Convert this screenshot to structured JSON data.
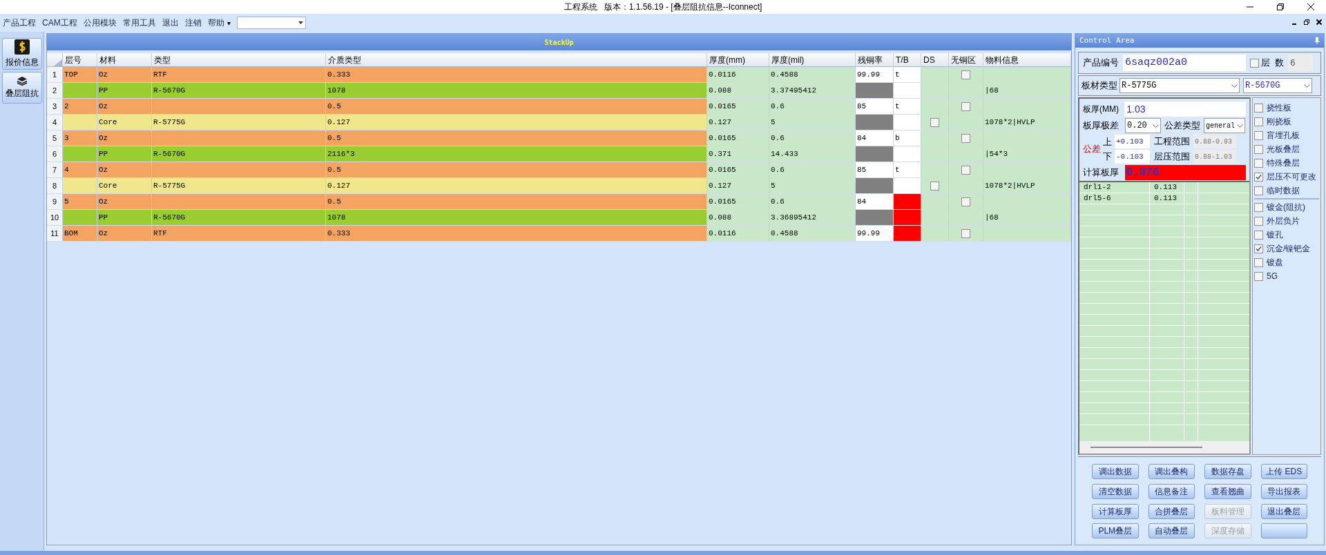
{
  "window": {
    "title": "工程系统   版本：1.1.56.19 - [叠层阻抗信息--Iconnect]"
  },
  "menu": {
    "items": [
      "产品工程",
      "CAM工程",
      "公用模块",
      "常用工具",
      "退出",
      "注销",
      "帮助"
    ],
    "overflow": "▾"
  },
  "sidebar": {
    "items": [
      {
        "label": "报价信息"
      },
      {
        "label": "叠层阻抗"
      }
    ]
  },
  "grid": {
    "title": "StackUp",
    "columns": [
      "层号",
      "材料",
      "类型",
      "介质类型",
      "厚度(mm)",
      "厚度(mil)",
      "残铜率",
      "T/B",
      "DS",
      "无铜区",
      "物料信息"
    ],
    "rows": [
      {
        "index": "1",
        "kind": "copper",
        "layer": "TOP",
        "material": "Oz",
        "type": "RTF",
        "dielectric": "0.333",
        "thk_mm": "0.0116",
        "thk_mil": "0.4588",
        "copper_rate": "99.99",
        "tb": "t",
        "tb_alert": false,
        "no_copper": false
      },
      {
        "index": "2",
        "kind": "pp",
        "material": "PP",
        "type": "R-5670G",
        "dielectric": "1078",
        "thk_mm": "0.088",
        "thk_mil": "3.37495412",
        "tb_alert": false,
        "info": "|68"
      },
      {
        "index": "3",
        "kind": "copper",
        "layer": "2",
        "material": "Oz",
        "dielectric": "0.5",
        "thk_mm": "0.0165",
        "thk_mil": "0.6",
        "copper_rate": "85",
        "tb": "t",
        "tb_alert": false,
        "no_copper": false
      },
      {
        "index": "4",
        "kind": "core",
        "material": "Core",
        "type": "R-5775G",
        "dielectric": "0.127",
        "thk_mm": "0.127",
        "thk_mil": "5",
        "tb_alert": false,
        "ds": false,
        "info": "1078*2|HVLP"
      },
      {
        "index": "5",
        "kind": "copper",
        "layer": "3",
        "material": "Oz",
        "dielectric": "0.5",
        "thk_mm": "0.0165",
        "thk_mil": "0.6",
        "copper_rate": "84",
        "tb": "b",
        "tb_alert": false,
        "no_copper": false
      },
      {
        "index": "6",
        "kind": "pp",
        "material": "PP",
        "type": "R-5670G",
        "dielectric": "2116*3",
        "thk_mm": "0.371",
        "thk_mil": "14.433",
        "tb_alert": false,
        "info": "|54*3"
      },
      {
        "index": "7",
        "kind": "copper",
        "layer": "4",
        "material": "Oz",
        "dielectric": "0.5",
        "thk_mm": "0.0165",
        "thk_mil": "0.6",
        "copper_rate": "85",
        "tb": "t",
        "tb_alert": false,
        "no_copper": false
      },
      {
        "index": "8",
        "kind": "core",
        "material": "Core",
        "type": "R-5775G",
        "dielectric": "0.127",
        "thk_mm": "0.127",
        "thk_mil": "5",
        "tb_alert": false,
        "ds": false,
        "info": "1078*2|HVLP"
      },
      {
        "index": "9",
        "kind": "copper",
        "layer": "5",
        "material": "Oz",
        "dielectric": "0.5",
        "thk_mm": "0.0165",
        "thk_mil": "0.6",
        "copper_rate": "84",
        "tb": "b",
        "tb_alert": true,
        "no_copper": false
      },
      {
        "index": "10",
        "kind": "pp",
        "material": "PP",
        "type": "R-5670G",
        "dielectric": "1078",
        "thk_mm": "0.088",
        "thk_mil": "3.36895412",
        "tb_alert": true,
        "info": "|68"
      },
      {
        "index": "11",
        "kind": "copper",
        "layer": "BOM",
        "material": "Oz",
        "type": "RTF",
        "dielectric": "0.333",
        "thk_mm": "0.0116",
        "thk_mil": "0.4588",
        "copper_rate": "99.99",
        "tb": "b",
        "tb_alert": true,
        "no_copper": false
      }
    ]
  },
  "control_area": {
    "title": "Control Area",
    "product_label": "产品编号",
    "product_value": "6saqz002a0",
    "layer_count_checked": false,
    "layer_count_label": "层  数",
    "layer_count": "6",
    "board_type_label": "板材类型",
    "board_type": "R-5775G",
    "board_type_2": "R-5670G",
    "thickness_label": "板厚(MM)",
    "thickness": "1.03",
    "tolerance_label": "板厚极差",
    "tolerance": "0.20",
    "tolerance_type_label": "公差类型",
    "tolerance_type": "general",
    "deviation_label": "公差",
    "upper_label": "上",
    "upper": "+0.103",
    "lower_label": "下",
    "lower": "-0.103",
    "eng_range_label": "工程范围",
    "eng_range": "0.88-0.93",
    "press_range_label": "层压范围",
    "press_range": "0.88-1.03",
    "calc_label": "计算板厚",
    "calc_value": "0.876",
    "drills": [
      {
        "name": "drl1-2",
        "value": "0.113"
      },
      {
        "name": "drl5-6",
        "value": "0.113"
      }
    ],
    "options": [
      {
        "label": "挠性板",
        "checked": false
      },
      {
        "label": "刚挠板",
        "checked": false
      },
      {
        "label": "盲埋孔板",
        "checked": false
      },
      {
        "label": "光板叠层",
        "checked": false
      },
      {
        "label": "特殊叠层",
        "checked": false
      },
      {
        "label": "层压不可更改",
        "checked": true
      },
      {
        "label": "临时数据",
        "checked": false
      }
    ],
    "options_2": [
      {
        "label": "镀金(阻抗)",
        "checked": false
      },
      {
        "label": "外层负片",
        "checked": false
      },
      {
        "label": "镀孔",
        "checked": false
      },
      {
        "label": "沉金/镍钯金",
        "checked": true
      },
      {
        "label": "镀盘",
        "checked": false
      },
      {
        "label": "5G",
        "checked": false
      }
    ],
    "buttons": [
      {
        "label": "调出数据",
        "disabled": false
      },
      {
        "label": "调出叠构",
        "disabled": false
      },
      {
        "label": "数据存盘",
        "disabled": false
      },
      {
        "label": "上传 EDS",
        "disabled": false
      },
      {
        "label": "清空数据",
        "disabled": false
      },
      {
        "label": "信息备注",
        "disabled": false
      },
      {
        "label": "查看翘曲",
        "disabled": false
      },
      {
        "label": "导出报表",
        "disabled": false
      },
      {
        "label": "计算板厚",
        "disabled": false
      },
      {
        "label": "合拼叠层",
        "disabled": false
      },
      {
        "label": "板料管理",
        "disabled": true
      },
      {
        "label": "退出叠层",
        "disabled": false
      },
      {
        "label": "PLM叠层",
        "disabled": false
      },
      {
        "label": "自动叠层",
        "disabled": false
      },
      {
        "label": "深度存储",
        "disabled": true
      },
      {
        "disabled": false
      }
    ]
  }
}
